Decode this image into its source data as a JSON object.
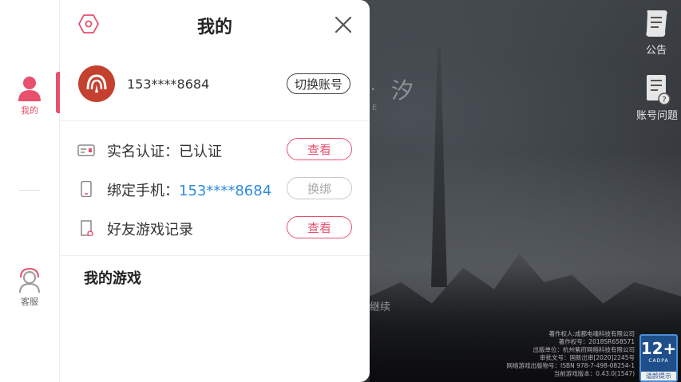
{
  "panel": {
    "title": "我的",
    "account": {
      "phone": "153****8684",
      "switch_label": "切换账号"
    },
    "rows": [
      {
        "label": "实名认证：已认证",
        "action": "查看"
      },
      {
        "label": "绑定手机：",
        "value": "153****8684",
        "action": "换绑"
      },
      {
        "label": "好友游戏记录",
        "action": "查看"
      }
    ],
    "section_title": "我的游戏"
  },
  "left_rail": {
    "items": [
      {
        "label": "我的",
        "active": true
      },
      {
        "label": "客服",
        "active": false
      }
    ]
  },
  "game": {
    "logo_dot": "·",
    "logo_char": "汐",
    "logo_sub": "E",
    "continue_text": "继续",
    "right_buttons": [
      {
        "label": "公告",
        "icon": "scroll-icon"
      },
      {
        "label": "账号问题",
        "icon": "document-question-icon"
      }
    ],
    "credits": [
      "著作权人:成都电魂科技有限公司",
      "著作权号：2018SR658571",
      "出版单位：杭州紫府网络科技有限公司",
      "审批文号：国新出审[2020]2245号",
      "网络游戏出版物号：ISBN 978-7-498-08254-1",
      "当前游戏版本：0.43.0(1547)"
    ],
    "age_rating": {
      "age": "12+",
      "org": "CADPA",
      "tip": "适龄提示"
    }
  },
  "colors": {
    "accent": "#e8506c",
    "link": "#2f8be0",
    "avatar": "#c4402f"
  }
}
